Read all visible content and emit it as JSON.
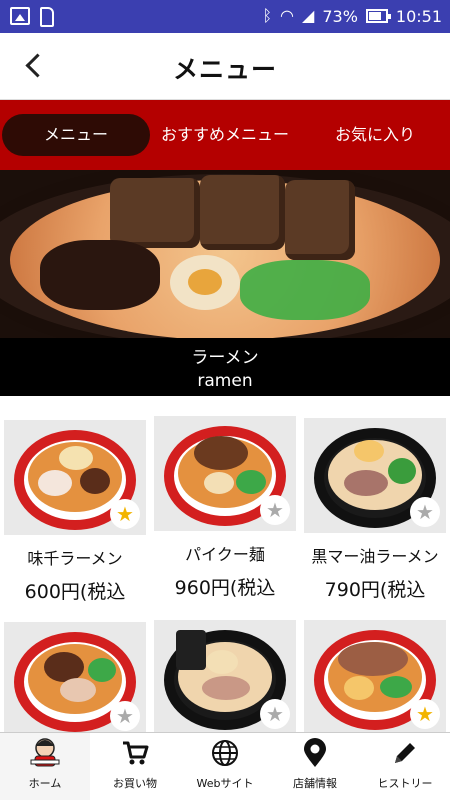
{
  "status_bar": {
    "battery": "73%",
    "time": "10:51",
    "icons": [
      "image-icon",
      "sd-card-icon",
      "bluetooth-icon",
      "wifi-icon",
      "signal-icon",
      "battery-icon"
    ]
  },
  "header": {
    "title": "メニュー"
  },
  "tabs": [
    {
      "label": "メニュー",
      "active": true
    },
    {
      "label": "おすすめメニュー",
      "active": false
    },
    {
      "label": "お気に入り",
      "active": false
    }
  ],
  "category": {
    "jp": "ラーメン",
    "en": "ramen"
  },
  "items": [
    {
      "name": "味千ラーメン",
      "price": "600円(税込",
      "favorite": true
    },
    {
      "name": "パイクー麺",
      "price": "960円(税込",
      "favorite": false
    },
    {
      "name": "黒マー油ラーメン",
      "price": "790円(税込",
      "favorite": false
    },
    {
      "name": "",
      "price": "",
      "favorite": false
    },
    {
      "name": "",
      "price": "",
      "favorite": false
    },
    {
      "name": "",
      "price": "",
      "favorite": true
    }
  ],
  "bottom_nav": [
    {
      "label": "ホーム",
      "icon": "mascot-icon"
    },
    {
      "label": "お買い物",
      "icon": "cart-icon"
    },
    {
      "label": "Webサイト",
      "icon": "globe-icon"
    },
    {
      "label": "店舗情報",
      "icon": "location-pin-icon"
    },
    {
      "label": "ヒストリー",
      "icon": "pencil-icon"
    }
  ],
  "colors": {
    "status_bar": "#3b3fb0",
    "tab_bar": "#b40000",
    "active_tab": "#2e0b05",
    "favorite_star": "#f2b400"
  }
}
